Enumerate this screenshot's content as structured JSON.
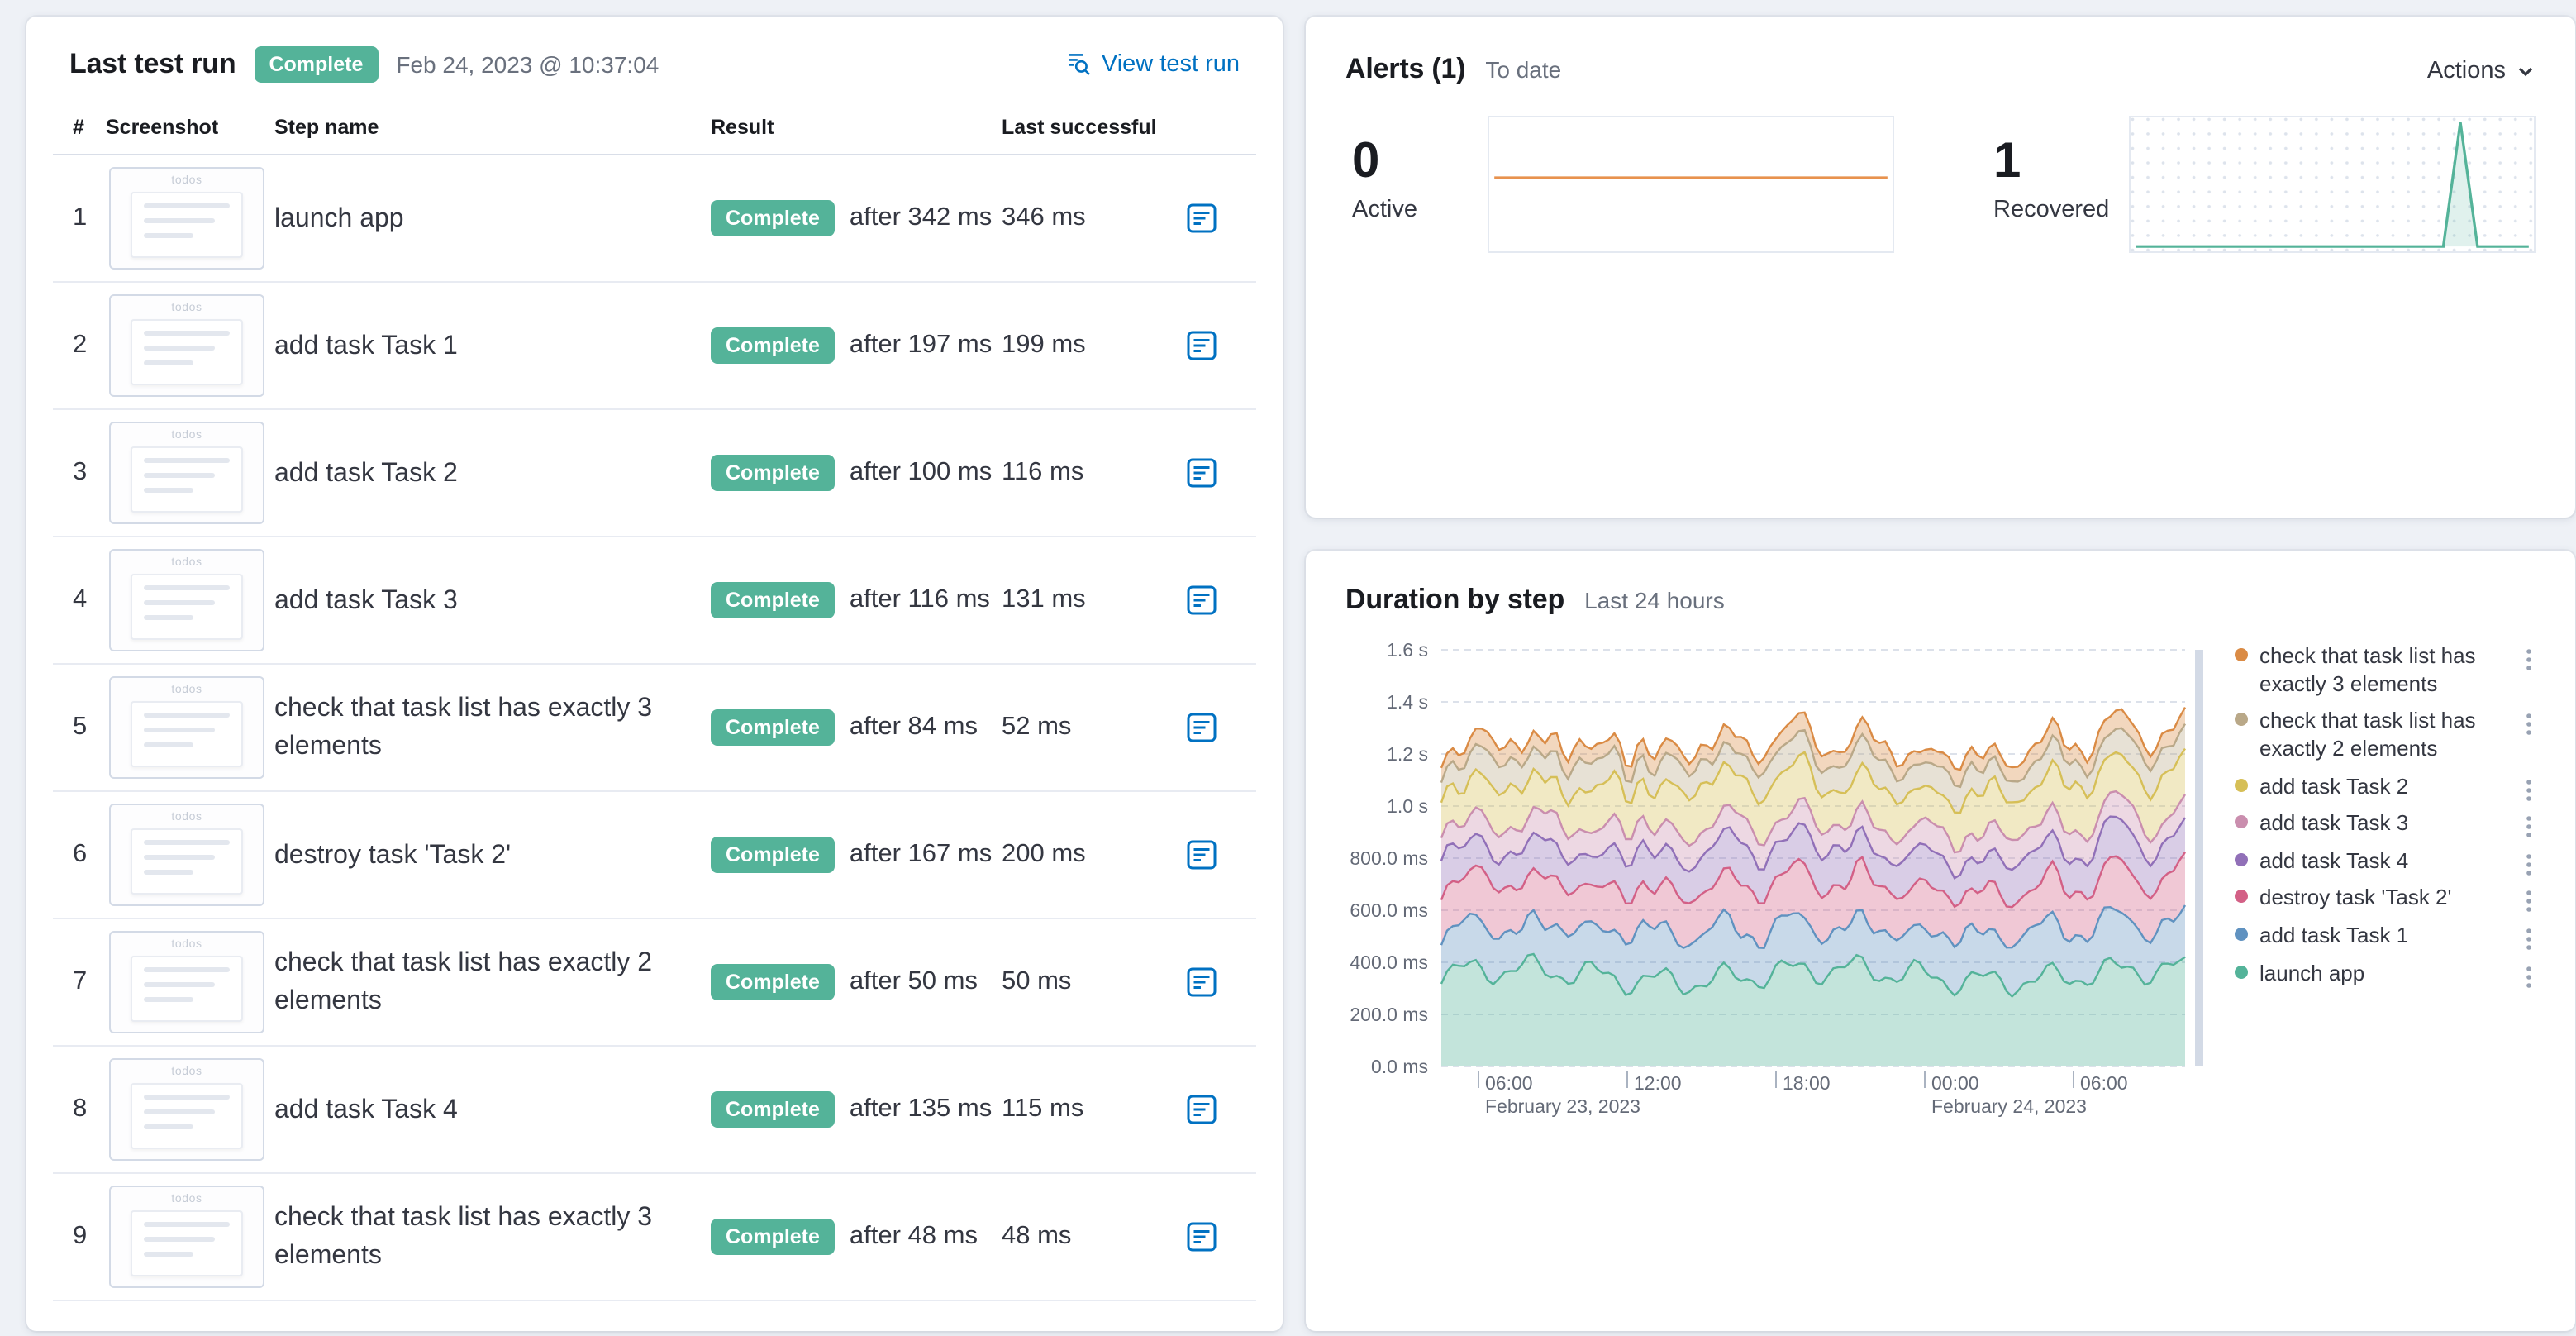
{
  "ui": {
    "colors": {
      "link": "#0071c2",
      "badge_success": "#54b399",
      "text": "#343741",
      "subdued": "#69707d",
      "active_spark": "#e8924e",
      "recovered_spark": "#54b399"
    }
  },
  "last_test_run": {
    "title": "Last test run",
    "status_badge": "Complete",
    "timestamp": "Feb 24, 2023 @ 10:37:04",
    "view_test_run": "View test run",
    "thumbnail_caption": "todos",
    "columns": {
      "num": "#",
      "screenshot": "Screenshot",
      "step_name": "Step name",
      "result": "Result",
      "last_successful": "Last successful"
    },
    "rows": [
      {
        "num": "1",
        "step": "launch app",
        "result_badge": "Complete",
        "result_after": "after 342 ms",
        "last_successful": "346 ms"
      },
      {
        "num": "2",
        "step": "add task Task 1",
        "result_badge": "Complete",
        "result_after": "after 197 ms",
        "last_successful": "199 ms"
      },
      {
        "num": "3",
        "step": "add task Task 2",
        "result_badge": "Complete",
        "result_after": "after 100 ms",
        "last_successful": "116 ms"
      },
      {
        "num": "4",
        "step": "add task Task 3",
        "result_badge": "Complete",
        "result_after": "after 116 ms",
        "last_successful": "131 ms"
      },
      {
        "num": "5",
        "step": "check that task list has exactly 3 elements",
        "result_badge": "Complete",
        "result_after": "after 84 ms",
        "last_successful": "52 ms"
      },
      {
        "num": "6",
        "step": "destroy task 'Task 2'",
        "result_badge": "Complete",
        "result_after": "after 167 ms",
        "last_successful": "200 ms"
      },
      {
        "num": "7",
        "step": "check that task list has exactly 2 elements",
        "result_badge": "Complete",
        "result_after": "after 50 ms",
        "last_successful": "50 ms"
      },
      {
        "num": "8",
        "step": "add task Task 4",
        "result_badge": "Complete",
        "result_after": "after 135 ms",
        "last_successful": "115 ms"
      },
      {
        "num": "9",
        "step": "check that task list has exactly 3 elements",
        "result_badge": "Complete",
        "result_after": "after 48 ms",
        "last_successful": "48 ms"
      }
    ]
  },
  "alerts": {
    "title": "Alerts (1)",
    "subtitle": "To date",
    "actions": "Actions",
    "active": {
      "value": "0",
      "label": "Active"
    },
    "recovered": {
      "value": "1",
      "label": "Recovered"
    }
  },
  "duration_by_step": {
    "title": "Duration by step",
    "subtitle": "Last 24 hours"
  },
  "chart_data": [
    {
      "id": "duration_by_step",
      "type": "area",
      "stacked": true,
      "title": "Duration by step",
      "subtitle": "Last 24 hours",
      "y_ticks": [
        "1.6 s",
        "1.4 s",
        "1.2 s",
        "1.0 s",
        "800.0 ms",
        "600.0 ms",
        "400.0 ms",
        "200.0 ms",
        "0.0 ms"
      ],
      "y_max_ms": 1600,
      "x_ticks": [
        "06:00",
        "12:00",
        "18:00",
        "00:00",
        "06:00"
      ],
      "x_tick_positions": [
        0.05,
        0.25,
        0.45,
        0.65,
        0.85
      ],
      "x_date_labels": [
        {
          "text": "February 23, 2023",
          "tick_index": 0
        },
        {
          "text": "February 24, 2023",
          "tick_index": 3
        }
      ],
      "grid": "dashed",
      "legend_position": "right",
      "series": [
        {
          "name": "launch app",
          "color": "#54B399",
          "avg_ms": 350
        },
        {
          "name": "add task Task 1",
          "color": "#6092C0",
          "avg_ms": 175
        },
        {
          "name": "destroy task 'Task 2'",
          "color": "#D36086",
          "avg_ms": 170
        },
        {
          "name": "add task Task 4",
          "color": "#9170B8",
          "avg_ms": 135
        },
        {
          "name": "add task Task 3",
          "color": "#CA8EAE",
          "avg_ms": 95
        },
        {
          "name": "add task Task 2",
          "color": "#D6BF57",
          "avg_ms": 155
        },
        {
          "name": "check that task list has exactly 2 elements",
          "color": "#B9A888",
          "avg_ms": 95
        },
        {
          "name": "check that task list has exactly 3 elements",
          "color": "#DA8B45",
          "avg_ms": 60
        }
      ],
      "legend": [
        {
          "label": "check that task list has exactly 3 elements",
          "color": "#DA8B45"
        },
        {
          "label": "check that task list has exactly 2 elements",
          "color": "#B9A888"
        },
        {
          "label": "add task Task 2",
          "color": "#D6BF57"
        },
        {
          "label": "add task Task 3",
          "color": "#CA8EAE"
        },
        {
          "label": "add task Task 4",
          "color": "#9170B8"
        },
        {
          "label": "destroy task 'Task 2'",
          "color": "#D36086"
        },
        {
          "label": "add task Task 1",
          "color": "#6092C0"
        },
        {
          "label": "launch app",
          "color": "#54B399"
        }
      ]
    },
    {
      "id": "alerts_active_sparkline",
      "type": "line",
      "label": "Active",
      "color": "#e8924e",
      "values": [
        0,
        0,
        0,
        0,
        0,
        0,
        0,
        0,
        0,
        0,
        0,
        0
      ]
    },
    {
      "id": "alerts_recovered_sparkline",
      "type": "line",
      "label": "Recovered",
      "color": "#54b399",
      "values": [
        0,
        0,
        0,
        0,
        0,
        0,
        0,
        0,
        0,
        0,
        0,
        0,
        0,
        0,
        0,
        0,
        0,
        0,
        0,
        1,
        0,
        0,
        0,
        0
      ]
    }
  ]
}
